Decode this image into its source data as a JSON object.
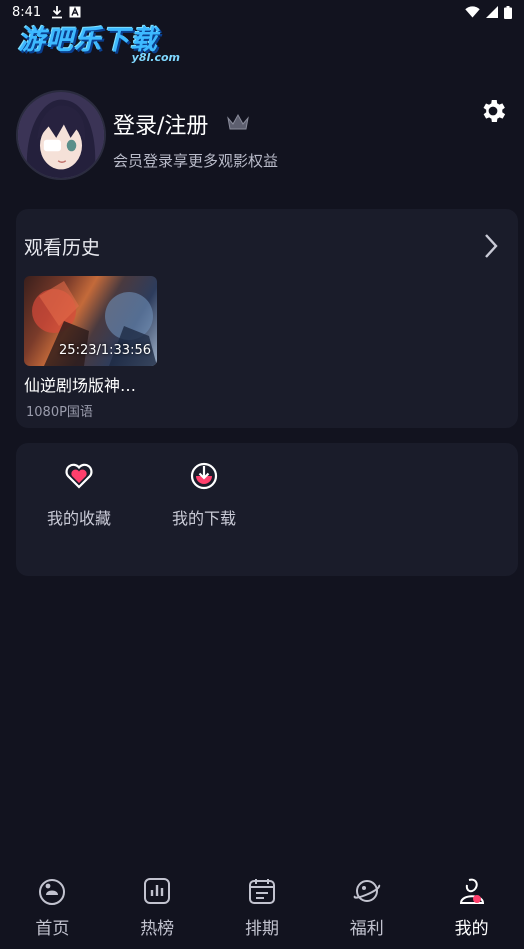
{
  "status_bar": {
    "time": "8:41"
  },
  "logo": {
    "main": "游吧乐下载",
    "sub": "y8l.com"
  },
  "profile": {
    "title": "登录/注册",
    "subtitle": "会员登录享更多观影权益"
  },
  "history": {
    "title": "观看历史",
    "items": [
      {
        "title": "仙逆剧场版神…",
        "meta": "1080P国语",
        "time": "25:23/1:33:56"
      }
    ]
  },
  "actions": {
    "favorites": "我的收藏",
    "downloads": "我的下载"
  },
  "nav": {
    "home": "首页",
    "hot": "热榜",
    "schedule": "排期",
    "welfare": "福利",
    "mine": "我的"
  },
  "colors": {
    "background": "#12131f",
    "card": "#1a1c2a",
    "accent": "#ff3f6c"
  }
}
